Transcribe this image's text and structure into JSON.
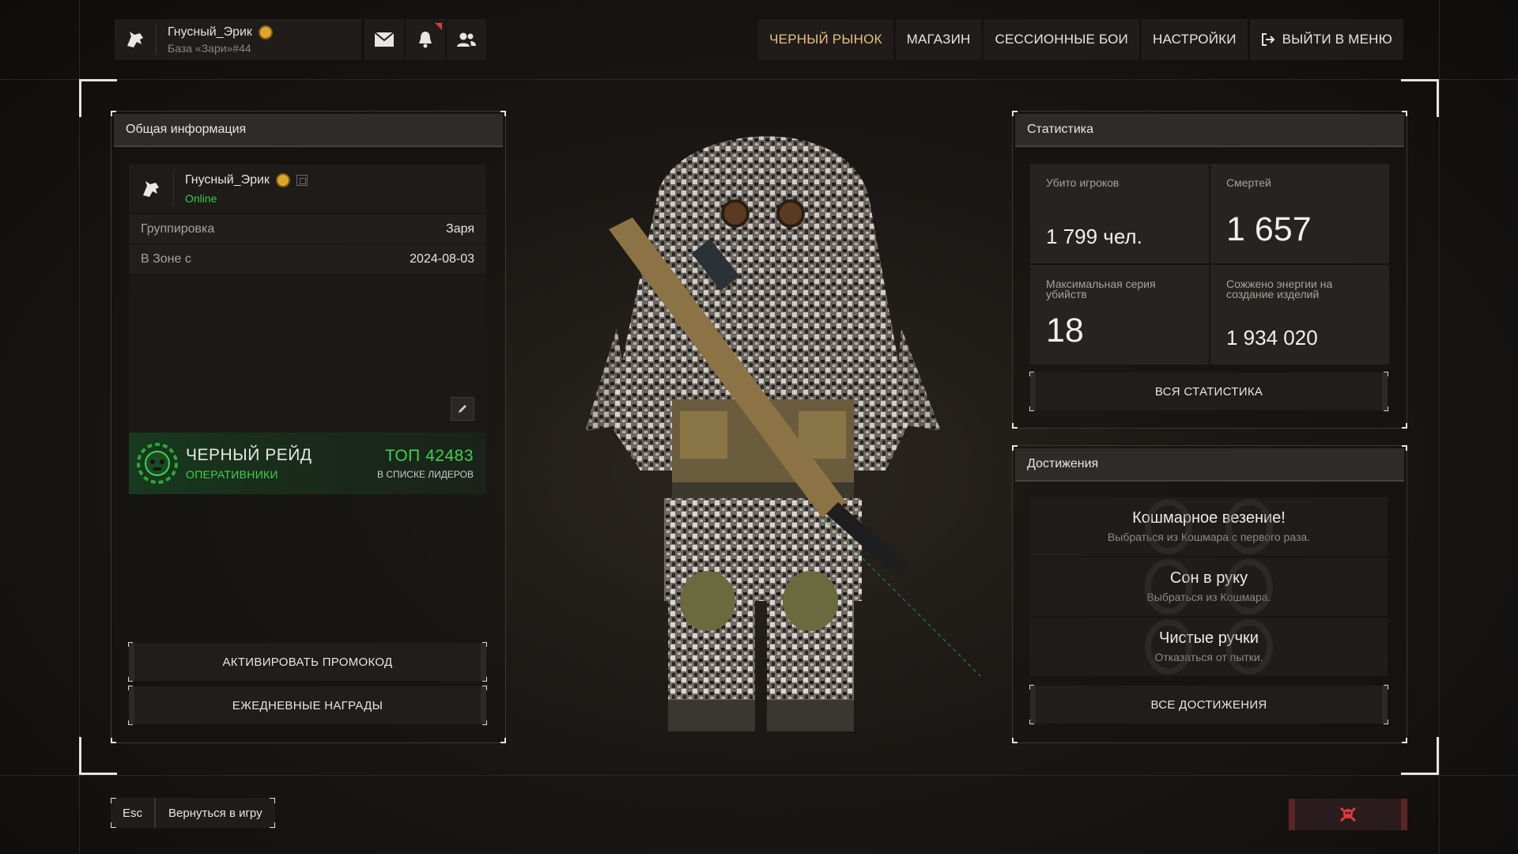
{
  "player": {
    "name": "Гнусный_Эрик",
    "base": "База «Зари»#44"
  },
  "nav": {
    "items": [
      "ЧЕРНЫЙ РЫНОК",
      "МАГАЗИН",
      "СЕССИОННЫЕ БОИ",
      "НАСТРОЙКИ",
      "ВЫЙТИ В МЕНЮ"
    ],
    "active_index": 0
  },
  "general": {
    "title": "Общая информация",
    "name": "Гнусный_Эрик",
    "status": "Online",
    "faction_label": "Группировка",
    "faction_value": "Заря",
    "zone_label": "В Зоне с",
    "zone_value": "2024-08-03",
    "raid_title": "ЧЕРНЫЙ РЕЙД",
    "raid_sub": "ОПЕРАТИВНИКИ",
    "raid_rank": "ТОП 42483",
    "raid_rank_sub": "В СПИСКЕ ЛИДЕРОВ",
    "promo_button": "АКТИВИРОВАТЬ ПРОМОКОД",
    "daily_button": "ЕЖЕДНЕВНЫЕ НАГРАДЫ"
  },
  "stats": {
    "title": "Статистика",
    "items": [
      {
        "label": "Убито игроков",
        "value": "1 799 чел."
      },
      {
        "label": "Смертей",
        "value": "1 657"
      },
      {
        "label": "Максимальная серия убийств",
        "value": "18"
      },
      {
        "label": "Сожжено энергии на создание изделий",
        "value": "1 934 020"
      }
    ],
    "all_button": "ВСЯ СТАТИСТИКА"
  },
  "achievements": {
    "title": "Достижения",
    "items": [
      {
        "title": "Кошмарное везение!",
        "desc": "Выбраться из Кошмара с первого раза."
      },
      {
        "title": "Сон в руку",
        "desc": "Выбраться из Кошмара."
      },
      {
        "title": "Чистые ручки",
        "desc": "Отказаться от пытки."
      }
    ],
    "all_button": "ВСЕ ДОСТИЖЕНИЯ"
  },
  "footer": {
    "esc_key": "Esc",
    "esc_label": "Вернуться в игру"
  },
  "colors": {
    "accent_gold": "#e8c07a",
    "online_green": "#38c94a",
    "raid_green": "#3dd24d",
    "report_red": "#e03a3a"
  }
}
